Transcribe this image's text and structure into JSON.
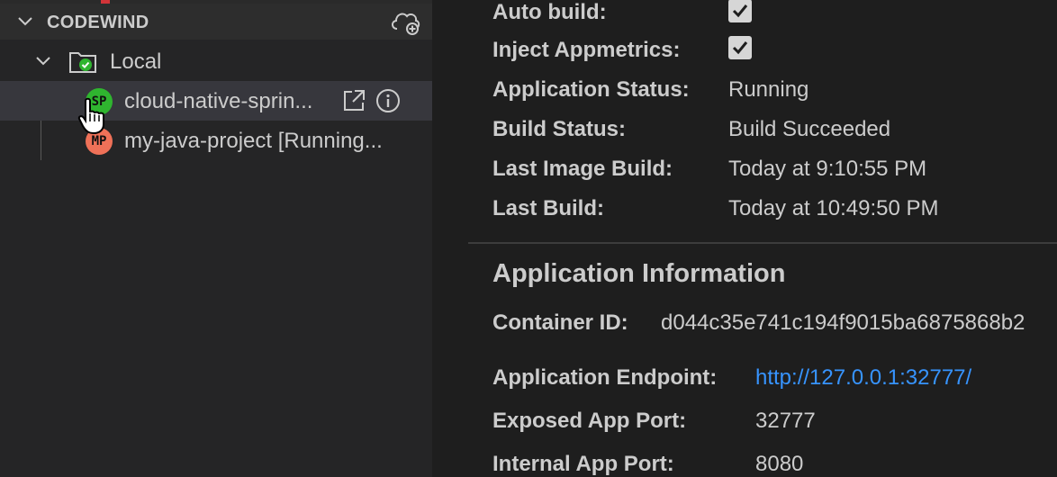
{
  "sidebar": {
    "section_title": "CODEWIND",
    "tree": {
      "root_label": "Local",
      "projects": [
        {
          "initials": "SP",
          "label": "cloud-native-sprin...",
          "color": "#2fb52f",
          "selected": true
        },
        {
          "initials": "MP",
          "label": "my-java-project [Running...",
          "color": "#ef7158",
          "selected": false
        }
      ]
    }
  },
  "overview": {
    "auto_build_label": "Auto build:",
    "auto_build_checked": true,
    "inject_label": "Inject Appmetrics:",
    "inject_checked": true,
    "app_status_label": "Application Status:",
    "app_status_value": "Running",
    "build_status_label": "Build Status:",
    "build_status_value": "Build Succeeded",
    "last_image_build_label": "Last Image Build:",
    "last_image_build_value": "Today at 9:10:55 PM",
    "last_build_label": "Last Build:",
    "last_build_value": "Today at 10:49:50 PM"
  },
  "app_info": {
    "heading": "Application Information",
    "container_id_label": "Container ID:",
    "container_id_value": "d044c35e741c194f9015ba6875868b2",
    "endpoint_label": "Application Endpoint:",
    "endpoint_value": "http://127.0.0.1:32777/",
    "exposed_port_label": "Exposed App Port:",
    "exposed_port_value": "32777",
    "internal_port_label": "Internal App Port:",
    "internal_port_value": "8080"
  },
  "colors": {
    "sidebar_bg": "#252526",
    "panel_bg": "#1e1e1e",
    "selection_bg": "#37373d",
    "link": "#3794ff",
    "success": "#2fb52f"
  }
}
